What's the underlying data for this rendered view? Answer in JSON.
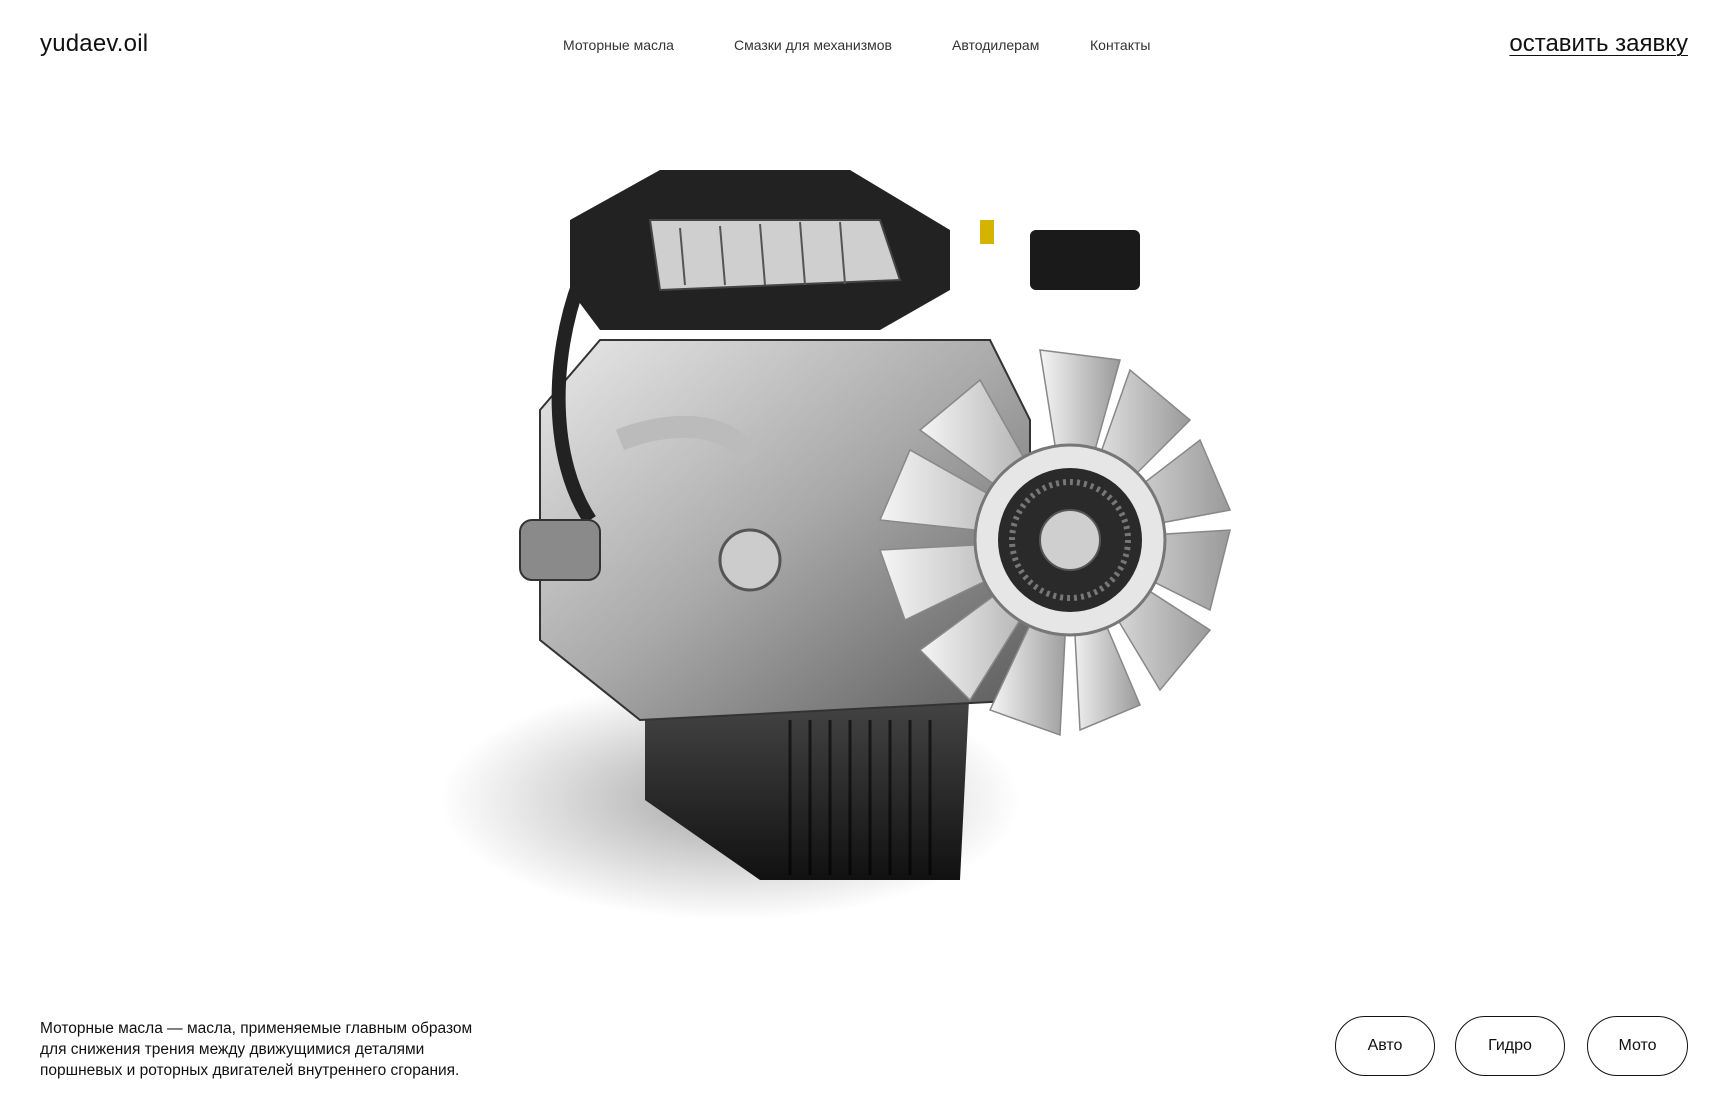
{
  "header": {
    "logo": "yudaev.oil",
    "nav": [
      {
        "label": "Моторные масла"
      },
      {
        "label": "Смазки для механизмов"
      },
      {
        "label": "Автодилерам"
      },
      {
        "label": "Контакты"
      }
    ],
    "cta_label": "оставить заявку"
  },
  "hero": {
    "image_icon": "engine-image"
  },
  "description": {
    "lines": [
      "Моторные масла — масла, применяемые главным образом",
      "для снижения трения между движущимися деталями",
      "поршневых и роторных двигателей внутреннего сгорания."
    ]
  },
  "categories": [
    {
      "label": "Авто"
    },
    {
      "label": "Гидро"
    },
    {
      "label": "Мото"
    }
  ]
}
